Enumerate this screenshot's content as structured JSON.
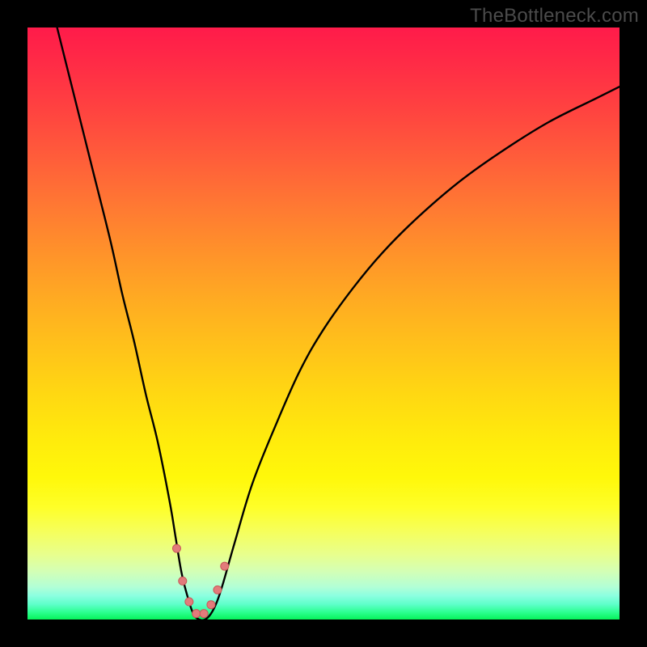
{
  "watermark": "TheBottleneck.com",
  "colors": {
    "frame": "#000000",
    "gradient_top": "#ff1b4a",
    "gradient_bottom": "#07f25a",
    "curve": "#000000",
    "marker_fill": "#e27b7b",
    "marker_stroke": "#c85858"
  },
  "chart_data": {
    "type": "line",
    "title": "",
    "xlabel": "",
    "ylabel": "",
    "xlim": [
      0,
      100
    ],
    "ylim": [
      0,
      100
    ],
    "series": [
      {
        "name": "bottleneck-curve",
        "x": [
          5,
          8,
          11,
          14,
          16,
          18,
          20,
          22,
          24,
          25,
          26,
          27,
          28,
          29,
          30,
          31,
          32,
          33,
          35,
          38,
          42,
          46,
          50,
          55,
          60,
          66,
          73,
          80,
          88,
          96,
          100
        ],
        "y": [
          100,
          88,
          76,
          64,
          55,
          47,
          38,
          30,
          20,
          14,
          8,
          4,
          1,
          0,
          0,
          1,
          3,
          6,
          13,
          23,
          33,
          42,
          49,
          56,
          62,
          68,
          74,
          79,
          84,
          88,
          90
        ]
      }
    ],
    "markers": {
      "name": "highlight-dots",
      "x": [
        25.2,
        26.2,
        27.3,
        28.5,
        29.8,
        31.0,
        32.1,
        33.3
      ],
      "y": [
        12.0,
        6.5,
        3.0,
        1.0,
        1.0,
        2.5,
        5.0,
        9.0
      ],
      "size": 10
    }
  }
}
